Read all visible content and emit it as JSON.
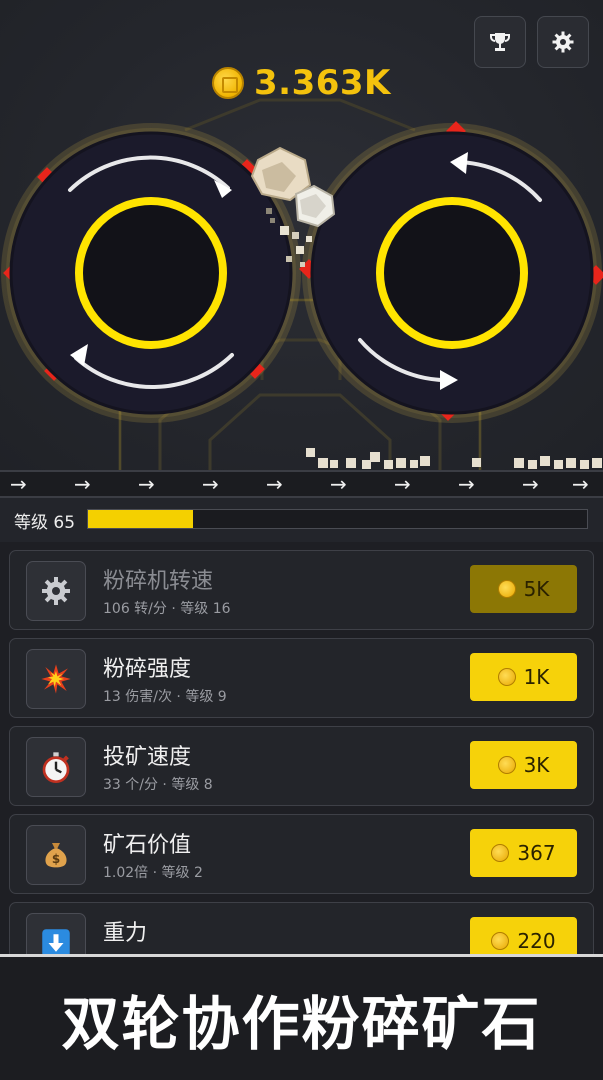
{
  "currency": {
    "value": "3.363K",
    "icon": "coin-icon"
  },
  "header_buttons": {
    "trophy_icon": "trophy-icon",
    "settings_icon": "gear-icon"
  },
  "level": {
    "label": "等级 65",
    "progress": 0.21
  },
  "upgrades": [
    {
      "title": "粉碎机转速",
      "sub": "106 转/分 · 等级 16",
      "price": "5K",
      "icon": "gear-icon",
      "enabled": false
    },
    {
      "title": "粉碎强度",
      "sub": "13 伤害/次 · 等级 9",
      "price": "1K",
      "icon": "explosion-icon",
      "enabled": true
    },
    {
      "title": "投矿速度",
      "sub": "33 个/分 · 等级 8",
      "price": "3K",
      "icon": "stopwatch-icon",
      "enabled": true
    },
    {
      "title": "矿石价值",
      "sub": "1.02倍 · 等级 2",
      "price": "367",
      "icon": "money-bag-icon",
      "enabled": true
    },
    {
      "title": "重力",
      "sub": "",
      "price": "220",
      "icon": "down-arrow-icon",
      "enabled": true
    }
  ],
  "banner": {
    "text": "双轮协作粉碎矿石"
  },
  "colors": {
    "accent": "#f6d20a",
    "ring": "#ffe400",
    "wheel": "#1b1a2b",
    "spike": "#e8251b",
    "background": "#23252b"
  }
}
